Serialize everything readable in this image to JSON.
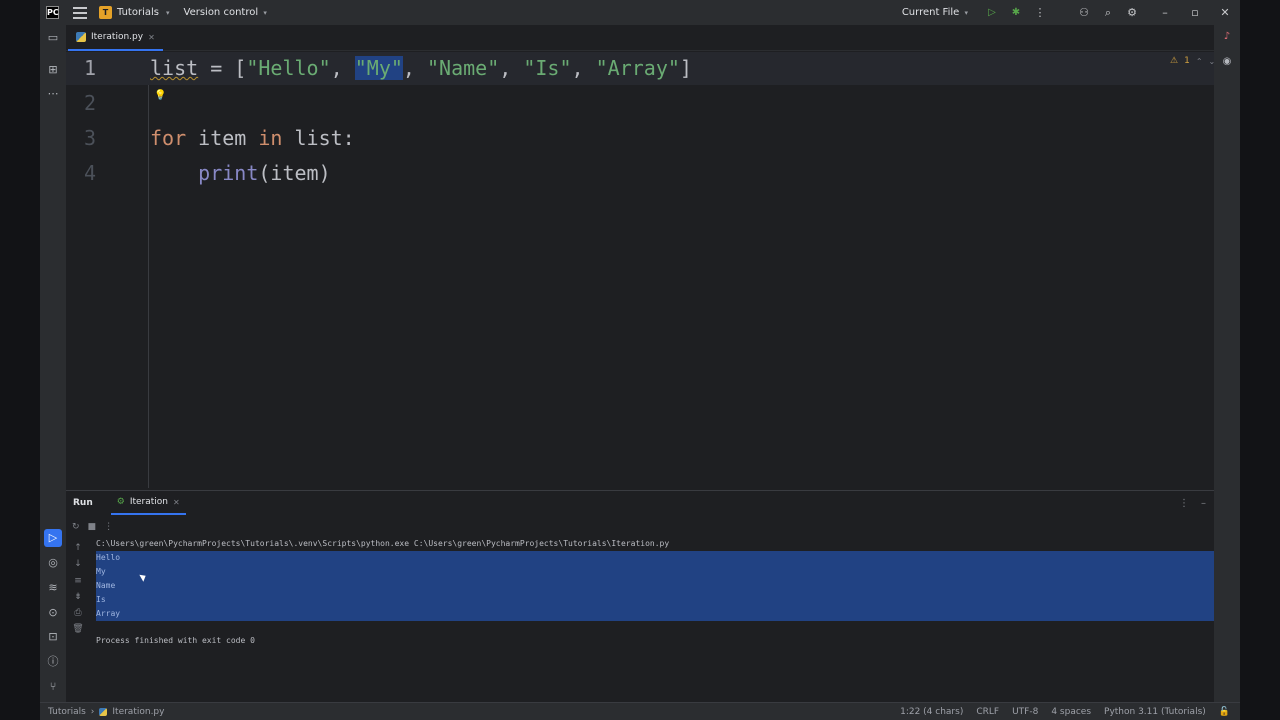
{
  "titlebar": {
    "logo": "PC",
    "project_badge": "T",
    "project_name": "Tutorials",
    "vcs_label": "Version control",
    "run_config": "Current File"
  },
  "tabs": [
    {
      "label": "Iteration.py"
    }
  ],
  "editor": {
    "line_numbers": [
      "1",
      "2",
      "3",
      "4"
    ],
    "line1": {
      "var": "list",
      "assign": " = [",
      "s1": "\"Hello\"",
      "c1": ", ",
      "s2": "\"My\"",
      "c2": ", ",
      "s3": "\"Name\"",
      "c3": ", ",
      "s4": "\"Is\"",
      "c4": ", ",
      "s5": "\"Array\"",
      "close": "]"
    },
    "line3": {
      "kw_for": "for",
      "sp1": " item ",
      "kw_in": "in",
      "rest": " list:"
    },
    "line4": {
      "indent": "    ",
      "fn": "print",
      "args": "(item)"
    },
    "inspection": {
      "warnings": "1"
    }
  },
  "run_panel": {
    "title": "Run",
    "tab_label": "Iteration",
    "command": "C:\\Users\\green\\PycharmProjects\\Tutorials\\.venv\\Scripts\\python.exe C:\\Users\\green\\PycharmProjects\\Tutorials\\Iteration.py",
    "output": [
      "Hello",
      "My",
      "Name",
      "Is",
      "Array"
    ],
    "exit_message": "Process finished with exit code 0"
  },
  "statusbar": {
    "crumb_project": "Tutorials",
    "crumb_file": "Iteration.py",
    "position": "1:22 (4 chars)",
    "line_sep": "CRLF",
    "encoding": "UTF-8",
    "indent": "4 spaces",
    "interpreter": "Python 3.11 (Tutorials)"
  },
  "colors": {
    "accent": "#3574f0",
    "selection": "#214283",
    "string": "#6aab73",
    "keyword": "#cf8e6d"
  }
}
